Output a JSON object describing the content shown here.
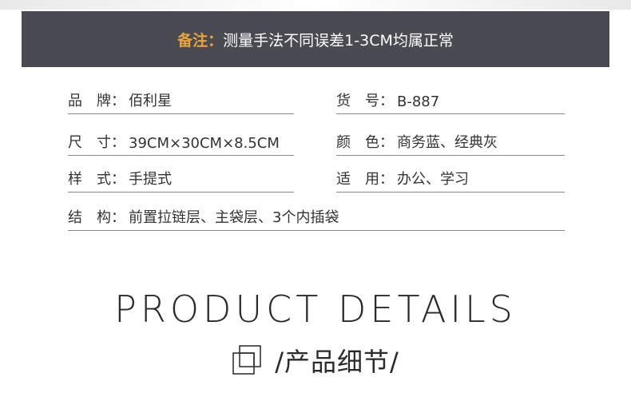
{
  "notice": {
    "label": "备注：",
    "text": "测量手法不同误差1-3CM均属正常"
  },
  "specs": {
    "brand": {
      "label": "品　牌：",
      "value": "佰利星"
    },
    "item_no": {
      "label": "货　号：",
      "value": "B-887"
    },
    "size": {
      "label": "尺　寸：",
      "value": "39CM×30CM×8.5CM"
    },
    "color": {
      "label": "颜　色：",
      "value": "商务蓝、经典灰"
    },
    "style": {
      "label": "样　式：",
      "value": "手提式"
    },
    "usage": {
      "label": "适　用：",
      "value": "办公、学习"
    },
    "structure": {
      "label": "结　构：",
      "value": "前置拉链层、主袋层、3个内插袋"
    }
  },
  "section": {
    "title": "PRODUCT DETAILS",
    "subtitle": "/产品细节/"
  },
  "icons": {
    "section_icon": "overlapping-squares-icon"
  },
  "colors": {
    "bar_bg": "#4a4a52",
    "accent": "#e8a33a",
    "text": "#333333"
  }
}
